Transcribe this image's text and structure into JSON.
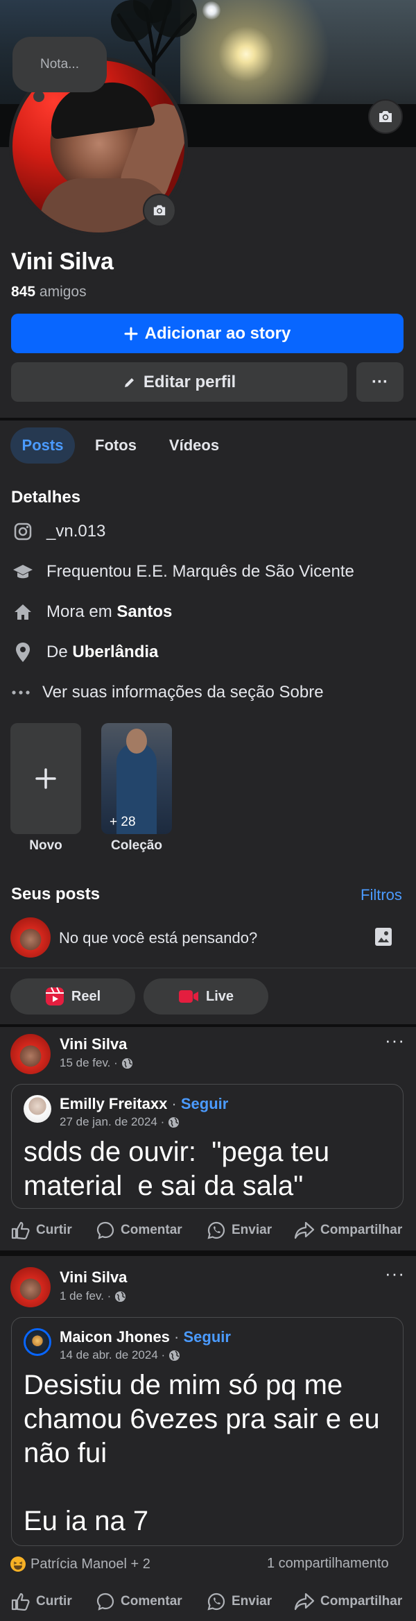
{
  "profile": {
    "note_placeholder": "Nota...",
    "name": "Vini Silva",
    "friends_count": "845",
    "friends_label": "amigos"
  },
  "buttons": {
    "add_story": "Adicionar ao story",
    "edit_profile": "Editar perfil",
    "more": "···"
  },
  "tabs": [
    "Posts",
    "Fotos",
    "Vídeos"
  ],
  "details": {
    "title": "Detalhes",
    "instagram": "_vn.013",
    "education": "Frequentou E.E. Marquês de São Vicente",
    "lives_prefix": "Mora em",
    "lives_city": "Santos",
    "from_prefix": "De",
    "from_city": "Uberlândia",
    "about_link": "Ver suas informações da seção Sobre"
  },
  "collections": {
    "new_label": "Novo",
    "collection_label": "Coleção",
    "collection_count": "+ 28"
  },
  "posts_section": {
    "title": "Seus posts",
    "filters": "Filtros",
    "composer_placeholder": "No que você está pensando?",
    "reel": "Reel",
    "live": "Live"
  },
  "posts": [
    {
      "author": "Vini Silva",
      "date": "15 de fev. ·",
      "shared_author": "Emilly Freitaxx",
      "follow": "Seguir",
      "shared_date": "27 de jan. de 2024 ·",
      "text": "sdds de ouvir:  \"pega teu material  e sai da sala\""
    },
    {
      "author": "Vini Silva",
      "date": "1 de fev. ·",
      "shared_author": "Maicon Jhones",
      "follow": "Seguir",
      "shared_date": "14 de abr. de 2024 ·",
      "text": "Desistiu de mim só pq me chamou 6vezes pra sair e eu não fui\n\nEu ia na 7",
      "reactions": "Patrícia Manoel + 2",
      "shares": "1 compartilhamento"
    }
  ],
  "actions": {
    "like": "Curtir",
    "comment": "Comentar",
    "send": "Enviar",
    "share": "Compartilhar"
  },
  "colors": {
    "background": "#252527",
    "accent": "#0866ff",
    "link": "#4b9bff",
    "button_gray": "#3a3b3c",
    "live_red": "#e41e3f"
  }
}
